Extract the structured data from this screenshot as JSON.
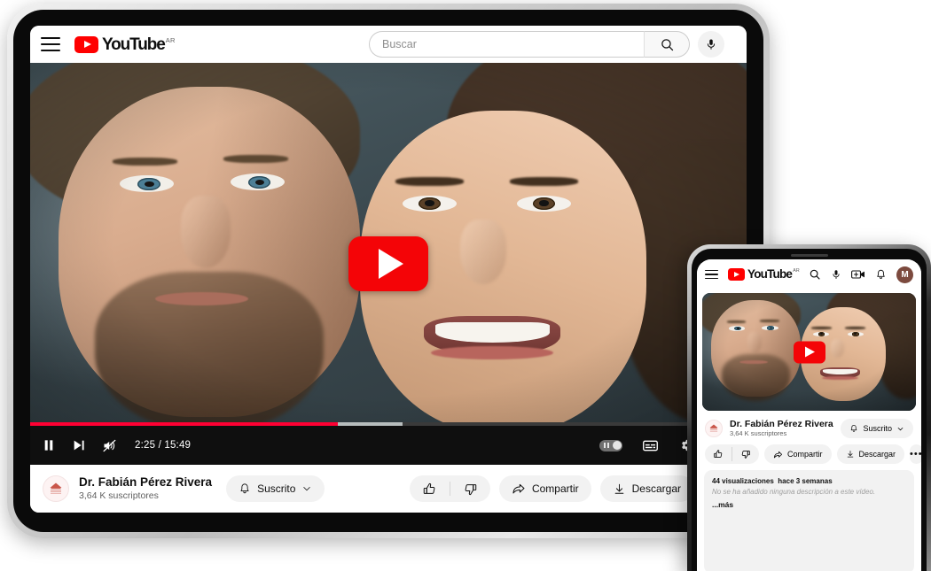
{
  "app": {
    "brand": "YouTube",
    "country_code": "AR",
    "accent_color": "#ff0000",
    "progress_color": "#ff0033"
  },
  "desktop": {
    "header": {
      "menu_icon": "hamburger-icon",
      "logo_label": "YouTube",
      "country_suffix": "AR",
      "search_placeholder": "Buscar",
      "search_value": "",
      "search_icon": "search-icon",
      "mic_icon": "microphone-icon"
    },
    "player": {
      "play_overlay_icon": "play-icon",
      "pause_icon": "pause-icon",
      "next_icon": "next-track-icon",
      "mute_icon": "volume-muted-icon",
      "time_display": "2:25 / 15:49",
      "current_time": "2:25",
      "duration": "15:49",
      "progress_percent": 43,
      "buffered_percent": 52,
      "autoplay_toggle_icon": "autoplay-toggle",
      "subtitles_icon": "subtitles-icon",
      "settings_icon": "gear-icon",
      "miniplayer_icon": "miniplayer-icon"
    },
    "channel": {
      "avatar_icon": "channel-avatar",
      "name": "Dr. Fabián Pérez Rivera",
      "subscribers": "3,64 K suscriptores",
      "subscribe_label": "Suscrito",
      "bell_icon": "bell-icon",
      "chevron_icon": "chevron-down-icon"
    },
    "actions": {
      "like_icon": "thumbs-up-icon",
      "dislike_icon": "thumbs-down-icon",
      "share_label": "Compartir",
      "share_icon": "share-icon",
      "download_label": "Descargar",
      "download_icon": "download-icon",
      "clip_icon": "clip-scissors-icon"
    }
  },
  "mobile": {
    "header": {
      "menu_icon": "hamburger-icon",
      "logo_label": "YouTube",
      "country_suffix": "AR",
      "search_icon": "search-icon",
      "mic_icon": "microphone-icon",
      "upload_icon": "create-video-icon",
      "bell_icon": "bell-icon",
      "avatar_initial": "M"
    },
    "player": {
      "play_overlay_icon": "play-icon"
    },
    "channel": {
      "avatar_icon": "channel-avatar",
      "name": "Dr. Fabián Pérez Rivera",
      "subscribers": "3,64 K suscriptores",
      "subscribe_label": "Suscrito",
      "bell_icon": "bell-icon",
      "chevron_icon": "chevron-down-icon"
    },
    "actions": {
      "like_icon": "thumbs-up-icon",
      "dislike_icon": "thumbs-down-icon",
      "share_label": "Compartir",
      "share_icon": "share-icon",
      "download_label": "Descargar",
      "download_icon": "download-icon",
      "more_label": "•••"
    },
    "description": {
      "views": "44 visualizaciones",
      "published": "hace 3 semanas",
      "body": "No se ha añadido ninguna descripción a este vídeo.",
      "expand_label": "...más"
    }
  }
}
